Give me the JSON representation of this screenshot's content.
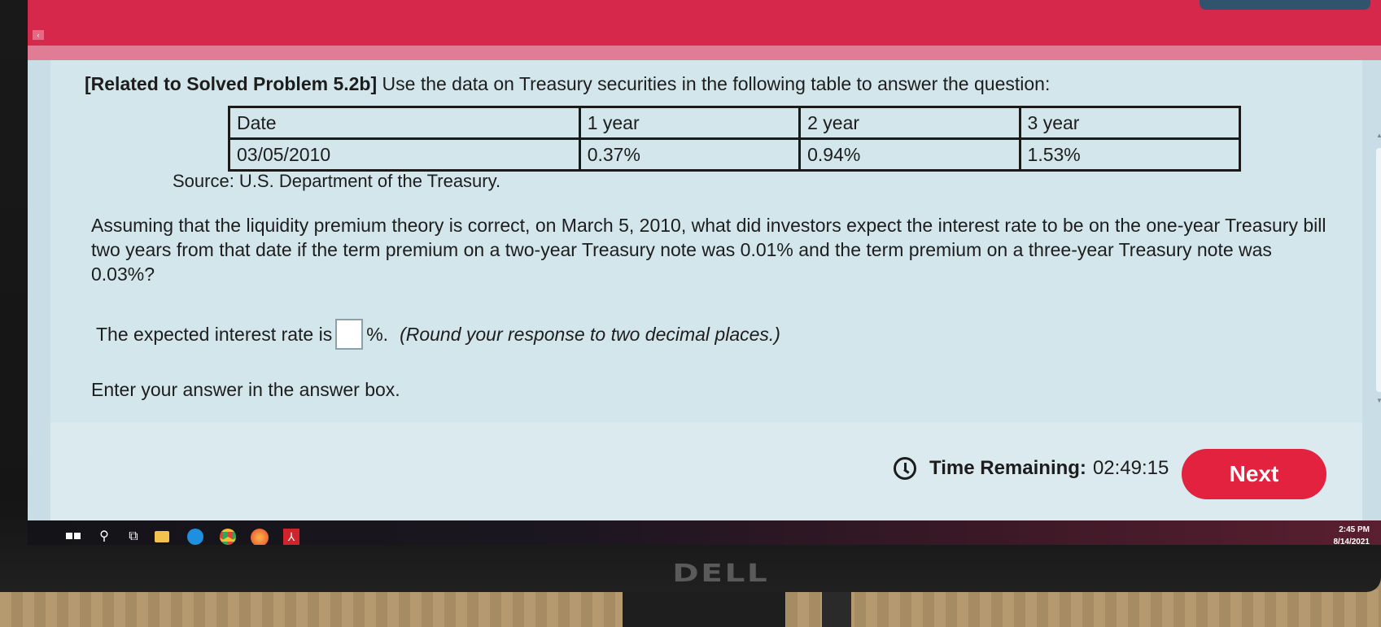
{
  "question": {
    "header_bold": "[Related to Solved Problem 5.2b]",
    "header_text": " Use the data on Treasury securities in the following table to answer the question:",
    "table": {
      "headers": [
        "Date",
        "1 year",
        "2 year",
        "3 year"
      ],
      "row": [
        "03/05/2010",
        "0.37%",
        "0.94%",
        "1.53%"
      ]
    },
    "source": "Source: U.S. Department of the Treasury.",
    "body": "Assuming that the liquidity premium theory is correct, on March 5, 2010, what did investors expect the interest rate to be on  the one-year Treasury bill two years from that date if the term premium on a two-year Treasury note was 0.01% and the term premium on a three-year Treasury note was 0.03%?",
    "answer_prefix": "The expected interest rate is",
    "answer_suffix": "%.",
    "answer_value": "",
    "rounding_note": "(Round your response to two decimal places.)",
    "instruction": "Enter your answer in the answer box."
  },
  "footer": {
    "time_label": "Time Remaining:",
    "time_value": "02:49:15",
    "next_label": "Next"
  },
  "taskbar": {
    "time": "2:45 PM",
    "date": "8/14/2021"
  },
  "monitor": {
    "brand": "DELL"
  },
  "colors": {
    "accent": "#d6284a",
    "next_button": "#e2223e",
    "content_bg": "#d3e6ec"
  }
}
